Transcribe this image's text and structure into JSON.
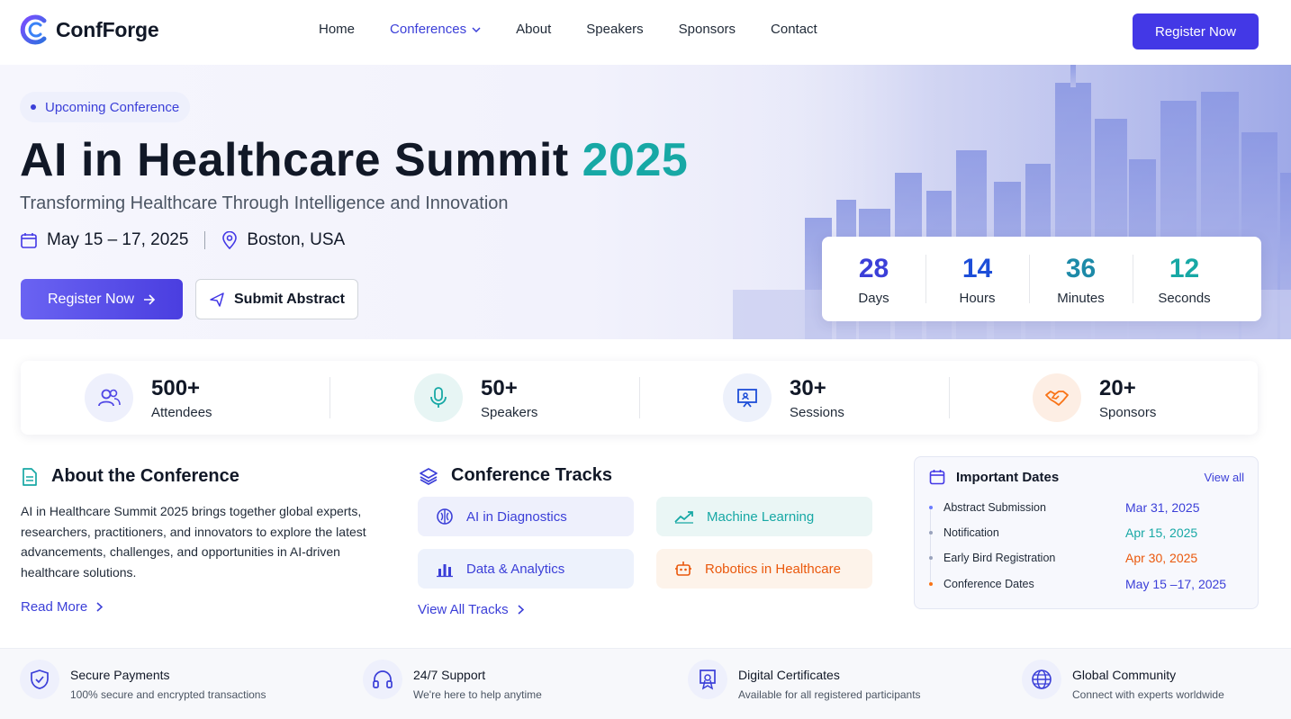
{
  "brand": {
    "name": "ConfForge"
  },
  "nav": {
    "links": [
      "Home",
      "Conferences",
      "About",
      "Speakers",
      "Sponsors",
      "Contact"
    ],
    "cta": "Register Now"
  },
  "hero": {
    "badge": "Upcoming Conference",
    "title_main": "AI in Healthcare Summit",
    "title_year": "2025",
    "subtitle": "Transforming Healthcare Through Intelligence and Innovation",
    "date": "May 15 – 17, 2025",
    "location": "Boston, USA",
    "primary_button": "Register Now",
    "secondary_button": "Submit Abstract"
  },
  "countdown": [
    {
      "value": "28",
      "label": "Days"
    },
    {
      "value": "14",
      "label": "Hours"
    },
    {
      "value": "36",
      "label": "Minutes"
    },
    {
      "value": "12",
      "label": "Seconds"
    }
  ],
  "stats": [
    {
      "value": "500+",
      "label": "Attendees",
      "icon": "users-icon",
      "color": "#4f46e5"
    },
    {
      "value": "50+",
      "label": "Speakers",
      "icon": "microphone-icon",
      "color": "#17a8a5"
    },
    {
      "value": "30+",
      "label": "Sessions",
      "icon": "presentation-icon",
      "color": "#1d4ed8"
    },
    {
      "value": "20+",
      "label": "Sponsors",
      "icon": "handshake-icon",
      "color": "#f97316"
    }
  ],
  "about": {
    "heading": "About the Conference",
    "body": "AI in Healthcare Summit 2025 brings together global experts, researchers, practitioners, and innovators to explore the latest advancements, challenges, and opportunities in AI-driven healthcare solutions.",
    "link": "Read More"
  },
  "tracks": {
    "heading": "Conference Tracks",
    "items": [
      {
        "label": "AI in Diagnostics",
        "icon": "brain-icon",
        "color": "#3b3fd8",
        "bg": "#eef0fc"
      },
      {
        "label": "Machine Learning",
        "icon": "trend-icon",
        "color": "#17a8a5",
        "bg": "#eaf6f5"
      },
      {
        "label": "Data & Analytics",
        "icon": "bar-chart-icon",
        "color": "#3b3fd8",
        "bg": "#edf2fc"
      },
      {
        "label": "Robotics in Healthcare",
        "icon": "robot-icon",
        "color": "#ea580c",
        "bg": "#fdf3ea"
      }
    ],
    "link": "View All Tracks"
  },
  "dates": {
    "heading": "Important Dates",
    "view_all": "View all",
    "items": [
      {
        "label": "Abstract Submission",
        "value": "Mar 31, 2025",
        "color": "#3b3fd8"
      },
      {
        "label": "Notification",
        "value": "Apr 15, 2025",
        "color": "#17a8a5"
      },
      {
        "label": "Early Bird Registration",
        "value": "Apr 30, 2025",
        "color": "#ea580c"
      },
      {
        "label": "Conference Dates",
        "value": "May 15 –17, 2025",
        "color": "#3b3fd8"
      }
    ]
  },
  "features": [
    {
      "title": "Secure Payments",
      "desc": "100% secure and encrypted transactions",
      "icon": "shield-icon"
    },
    {
      "title": "24/7 Support",
      "desc": "We're here to help anytime",
      "icon": "headset-icon"
    },
    {
      "title": "Digital Certificates",
      "desc": "Available for all registered participants",
      "icon": "certificate-icon"
    },
    {
      "title": "Global Community",
      "desc": "Connect with experts worldwide",
      "icon": "globe-icon"
    }
  ]
}
